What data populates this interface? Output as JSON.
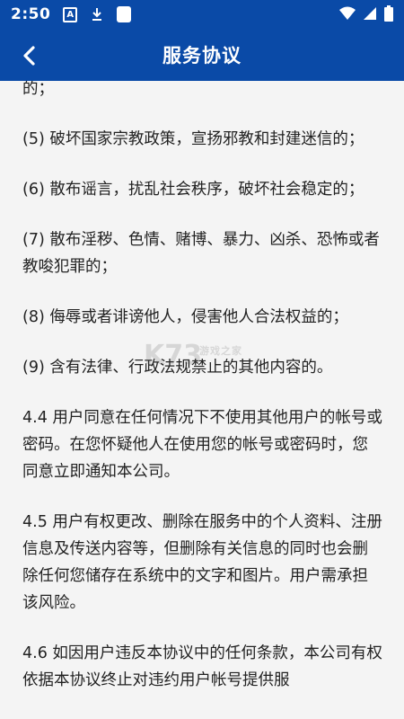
{
  "status_bar": {
    "time": "2:50",
    "icons": [
      "a-notification-icon",
      "download-icon",
      "app-square-icon",
      "wifi-icon",
      "signal-icon",
      "battery-icon"
    ]
  },
  "app_bar": {
    "title": "服务协议",
    "back_icon": "chevron-left-icon"
  },
  "content": {
    "paragraphs": [
      "的；",
      "(5) 破坏国家宗教政策，宣扬邪教和封建迷信的；",
      "(6) 散布谣言，扰乱社会秩序，破坏社会稳定的；",
      "(7) 散布淫秽、色情、赌博、暴力、凶杀、恐怖或者教唆犯罪的；",
      "(8) 侮辱或者诽谤他人，侵害他人合法权益的；",
      "(9) 含有法律、行政法规禁止的其他内容的。",
      "4.4 用户同意在任何情况下不使用其他用户的帐号或密码。在您怀疑他人在使用您的帐号或密码时，您同意立即通知本公司。",
      "4.5 用户有权更改、删除在服务中的个人资料、注册信息及传送内容等，但删除有关信息的同时也会删除任何您储存在系统中的文字和图片。用户需承担该风险。",
      "4.6 如因用户违反本协议中的任何条款，本公司有权依据本协议终止对违约用户帐号提供服"
    ]
  },
  "watermark": {
    "big": "K73",
    "small": "游戏之家"
  },
  "colors": {
    "primary": "#0a4aa7",
    "background": "#f4f4f4",
    "text": "#222222"
  }
}
